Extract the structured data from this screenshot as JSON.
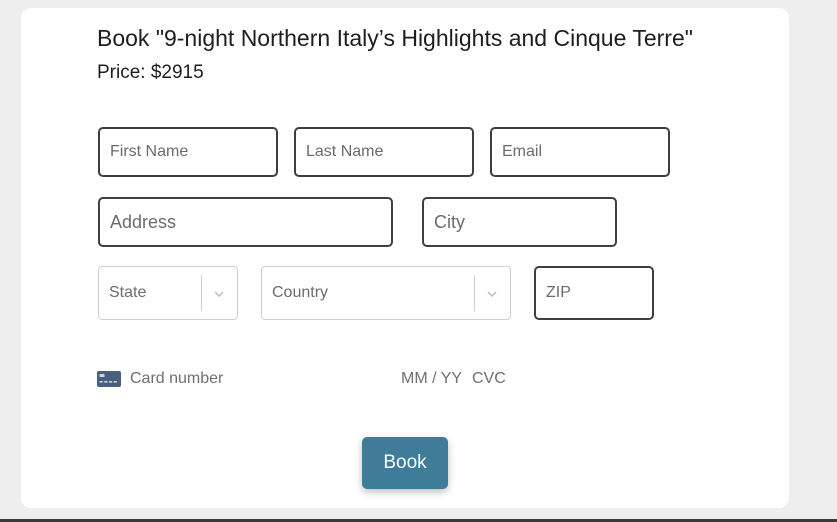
{
  "booking": {
    "title": "Book \"9-night Northern Italy’s Highlights and Cinque Terre\"",
    "price": "Price: $2915"
  },
  "form": {
    "first_name_placeholder": "First Name",
    "last_name_placeholder": "Last Name",
    "email_placeholder": "Email",
    "address_placeholder": "Address",
    "city_placeholder": "City",
    "state_label": "State",
    "country_label": "Country",
    "zip_placeholder": "ZIP"
  },
  "payment": {
    "card_icon": "credit-card-icon",
    "card_number_placeholder": "Card number",
    "expiry_placeholder": "MM / YY",
    "cvc_placeholder": "CVC"
  },
  "actions": {
    "book_label": "Book"
  },
  "colors": {
    "accent": "#3e7c9a",
    "field_border": "#3f3f3f",
    "select_border": "#cfcfcf",
    "background": "#eeeeee"
  }
}
